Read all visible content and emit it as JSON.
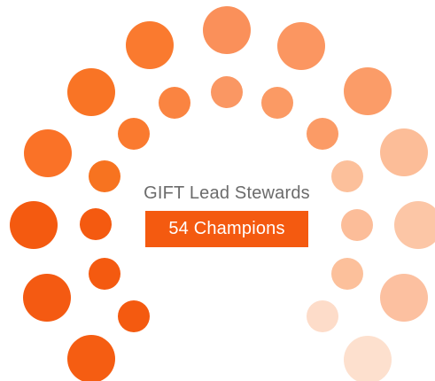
{
  "headline": "GIFT Lead Stewards",
  "badge": "54 Champions",
  "colors": {
    "background": "#ffffff",
    "headline": "#6b6b6b",
    "badge_background": "#f45a10",
    "badge_text": "#ffffff"
  }
}
